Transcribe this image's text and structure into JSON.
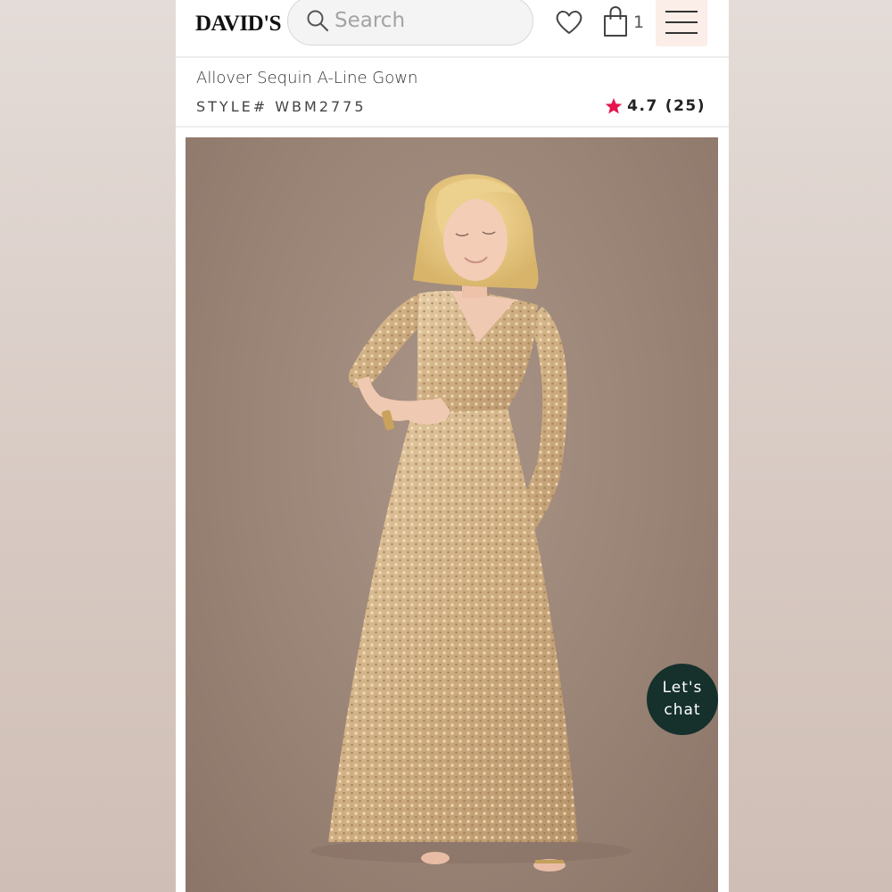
{
  "header": {
    "logo_text": "DAVID'S",
    "search_placeholder": "Search",
    "cart_count": "1",
    "icons": {
      "search": "search-icon",
      "wishlist": "heart-icon",
      "cart": "shopping-bag-icon",
      "menu": "hamburger-menu-icon"
    }
  },
  "product": {
    "title": "Allover Sequin A-Line Gown",
    "style_number": "STYLE# WBM2775",
    "rating": "4.7",
    "review_count": "(25)",
    "rating_star_color": "#e5174d"
  },
  "image": {
    "alt": "Model wearing gold allover sequin A-line gown"
  },
  "chat": {
    "label": "Let's\nchat"
  },
  "colors": {
    "accent": "#e5174d",
    "chat_bg": "#16302c",
    "menu_bg": "#fbeee8"
  }
}
